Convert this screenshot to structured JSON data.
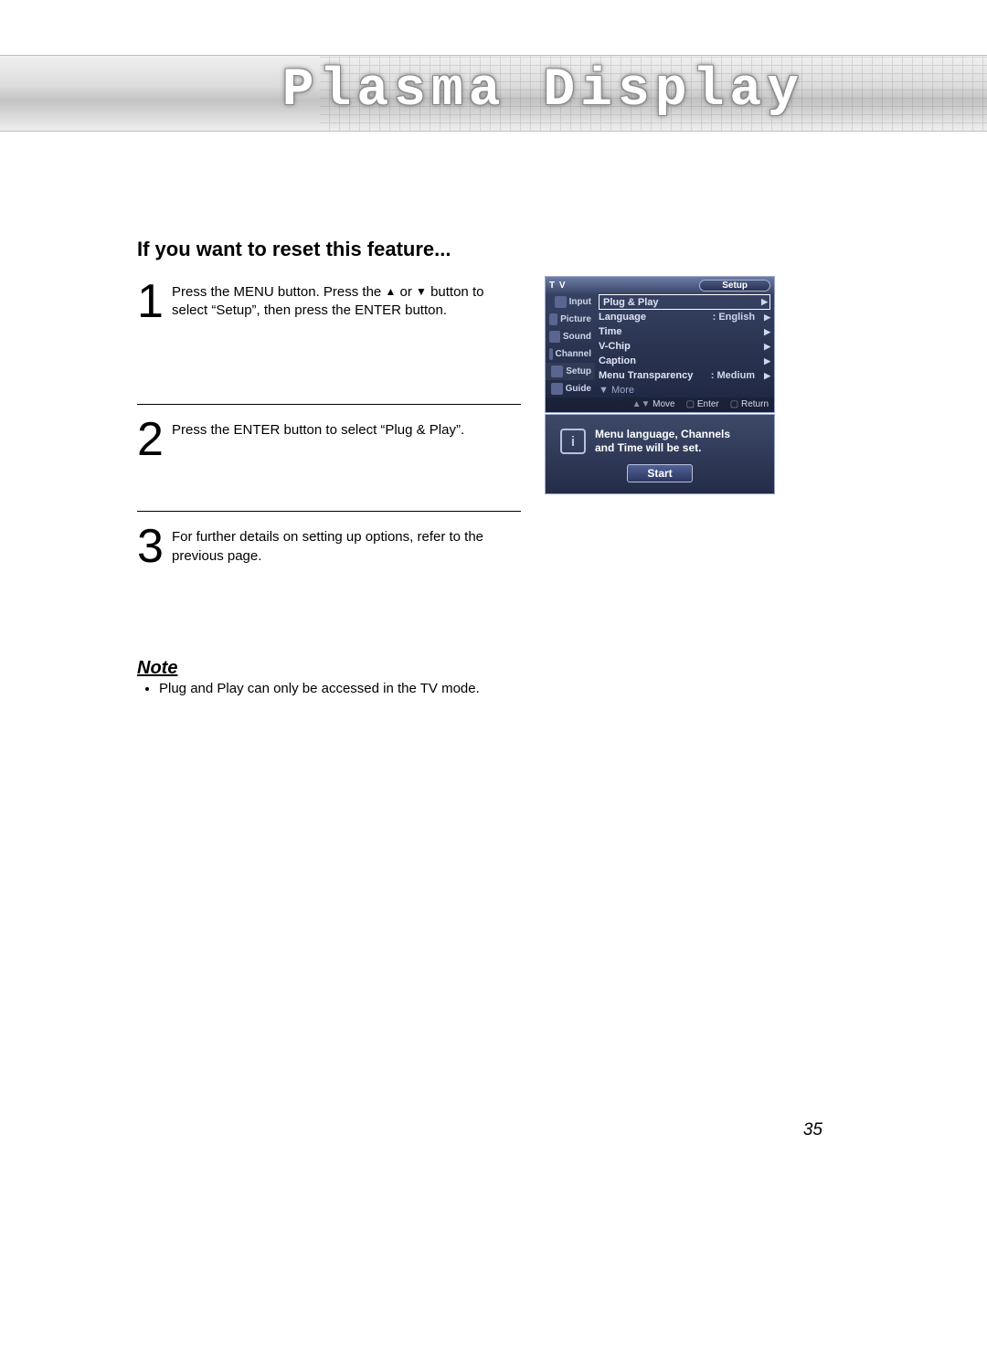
{
  "banner": {
    "title": "Plasma Display"
  },
  "section_heading": "If you want to reset this feature...",
  "steps": [
    {
      "num": "1",
      "text_a": "Press the MENU button. Press the ",
      "text_b": " or ",
      "text_c": " button to select “Setup”, then press the ENTER button."
    },
    {
      "num": "2",
      "text": "Press the ENTER button to select “Plug & Play”."
    },
    {
      "num": "3",
      "text": "For further details on setting up options, refer to the previous page."
    }
  ],
  "osd": {
    "tv": "T V",
    "title": "Setup",
    "side": [
      "Input",
      "Picture",
      "Sound",
      "Channel",
      "Setup",
      "Guide"
    ],
    "rows": [
      {
        "label": "Plug & Play",
        "selected": true
      },
      {
        "label": "Language",
        "value": ": English"
      },
      {
        "label": "Time"
      },
      {
        "label": "V-Chip"
      },
      {
        "label": "Caption"
      },
      {
        "label": "Menu Transparency",
        "value": ": Medium"
      },
      {
        "label": "▼ More",
        "more": true
      }
    ],
    "footer": {
      "move": "Move",
      "enter": "Enter",
      "return": "Return"
    }
  },
  "dialog": {
    "msg_line1": "Menu language, Channels",
    "msg_line2": "and Time will be set.",
    "button": "Start"
  },
  "note": {
    "heading": "Note",
    "item": "Plug and Play can only be accessed in the TV mode."
  },
  "page_number": "35"
}
